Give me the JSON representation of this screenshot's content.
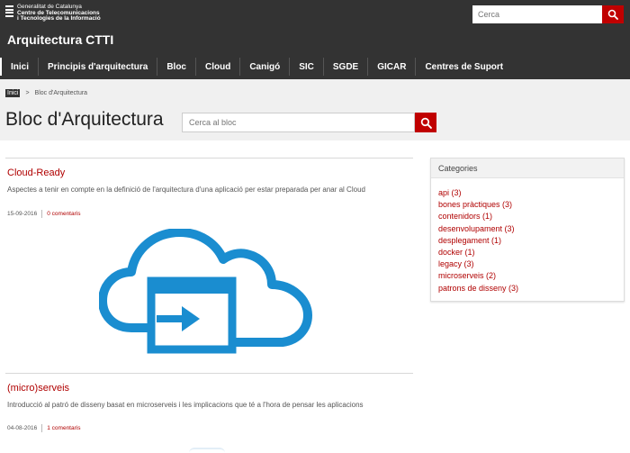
{
  "header": {
    "org_lines": [
      "Generalitat de Catalunya",
      "Centre de Telecomunicacions",
      "i Tecnologies de la Informació"
    ],
    "site_title": "Arquitectura CTTI",
    "search_placeholder": "Cerca"
  },
  "nav": {
    "items": [
      "Inici",
      "Principis d'arquitectura",
      "Bloc",
      "Cloud",
      "Canigó",
      "SIC",
      "SGDE",
      "GICAR",
      "Centres de Suport"
    ]
  },
  "breadcrumb": {
    "home": "Inici",
    "separator": ">",
    "current": "Bloc d'Arquitectura"
  },
  "page": {
    "title": "Bloc d'Arquitectura",
    "search_placeholder": "Cerca al bloc"
  },
  "posts": [
    {
      "title": "Cloud-Ready",
      "excerpt": "Aspectes a tenir en compte en la definició de l'arquitectura d'una aplicació per estar preparada per anar al Cloud",
      "date": "15-09-2016",
      "comments": "0 comentaris",
      "image_icon": "cloud-upload-icon"
    },
    {
      "title": "(micro)serveis",
      "excerpt": "Introducció al patró de disseny basat en microserveis i les implicacions que té a l'hora de pensar les aplicacions",
      "date": "04-08-2016",
      "comments": "1 comentaris"
    }
  ],
  "sidebar": {
    "categories_title": "Categories",
    "categories": [
      "api (3)",
      "bones pràctiques (3)",
      "contenidors (1)",
      "desenvolupament (3)",
      "desplegament (1)",
      "docker (1)",
      "legacy (3)",
      "microserveis (2)",
      "patrons de disseny (3)"
    ]
  },
  "colors": {
    "header_bg": "#333333",
    "accent": "#c00000",
    "link": "#b00000",
    "band_bg": "#f0f0f0",
    "cloud_blue": "#1a8dd0"
  }
}
